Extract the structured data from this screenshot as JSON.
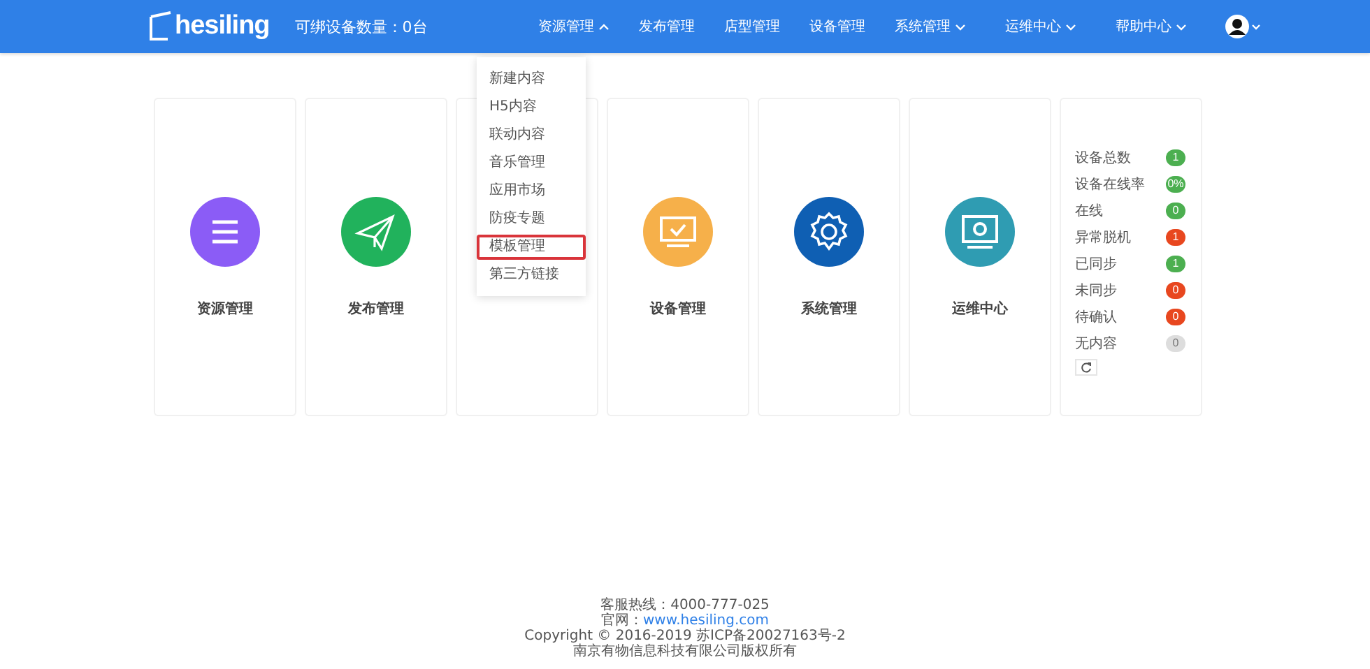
{
  "header": {
    "logo": "hesiling",
    "device_count": "可绑设备数量：0台",
    "nav": [
      {
        "label": "资源管理",
        "kind": "menu",
        "expanded": true
      },
      {
        "label": "发布管理",
        "kind": "link"
      },
      {
        "label": "店型管理",
        "kind": "link"
      },
      {
        "label": "设备管理",
        "kind": "link"
      },
      {
        "label": "系统管理",
        "kind": "menu",
        "expanded": false
      },
      {
        "label": "运维中心",
        "kind": "menu",
        "expanded": false
      },
      {
        "label": "帮助中心",
        "kind": "menu",
        "expanded": false
      }
    ]
  },
  "dropdown": [
    {
      "label": "新建内容",
      "selected": false
    },
    {
      "label": "H5内容",
      "selected": false
    },
    {
      "label": "联动内容",
      "selected": false
    },
    {
      "label": "音乐管理",
      "selected": false
    },
    {
      "label": "应用市场",
      "selected": false
    },
    {
      "label": "防疫专题",
      "selected": false
    },
    {
      "label": "模板管理",
      "selected": true
    },
    {
      "label": "第三方链接",
      "selected": false
    }
  ],
  "cards": [
    {
      "kind": "tile",
      "title": "资源管理"
    },
    {
      "kind": "tile",
      "title": "发布管理"
    },
    {
      "kind": "covered"
    },
    {
      "kind": "tile",
      "title": "设备管理"
    },
    {
      "kind": "tile",
      "title": "系统管理"
    },
    {
      "kind": "tile",
      "title": "运维中心"
    }
  ],
  "stats": [
    {
      "label": "设备总数",
      "value": "1",
      "color": "#4caf50"
    },
    {
      "label": "设备在线率",
      "value": "0%",
      "color": "#4caf50"
    },
    {
      "label": "在线",
      "value": "0",
      "color": "#4caf50"
    },
    {
      "label": "异常脱机",
      "value": "1",
      "color": "#e8471f"
    },
    {
      "label": "已同步",
      "value": "1",
      "color": "#4caf50"
    },
    {
      "label": "未同步",
      "value": "0",
      "color": "#e8471f"
    },
    {
      "label": "待确认",
      "value": "0",
      "color": "#e8471f"
    },
    {
      "label": "无内容",
      "value": "0",
      "color": "#dddddd"
    }
  ],
  "footer": {
    "hotline": "客服热线：4000-777-025",
    "site_label": "官网：",
    "site_link": "www.hesiling.com",
    "copyright": "Copyright © 2016-2019 苏ICP备20027163号-2",
    "company": "南京有物信息科技有限公司版权所有"
  }
}
